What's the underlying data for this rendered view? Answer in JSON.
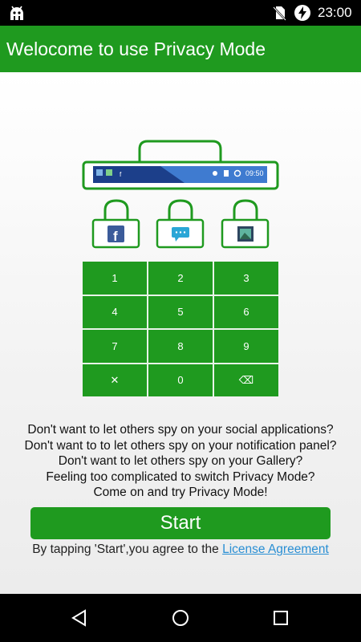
{
  "status_bar": {
    "time": "23:00",
    "icons": [
      "android-icon",
      "no-sim-icon",
      "battery-charging-icon"
    ]
  },
  "app_bar": {
    "title": "Welocome to use Privacy Mode"
  },
  "illustration": {
    "mini_status_time": "09:50",
    "locked_apps": [
      "facebook-icon",
      "messaging-icon",
      "gallery-icon"
    ]
  },
  "keypad": {
    "keys": [
      "1",
      "2",
      "3",
      "4",
      "5",
      "6",
      "7",
      "8",
      "9",
      "✕",
      "0",
      "⌫"
    ]
  },
  "message": {
    "lines": [
      "Don't want to let others spy on your social applications?",
      "Don't want to to let others spy on your notification panel?",
      "Don't want to let others spy on your Gallery?",
      "Feeling too complicated to switch Privacy Mode?",
      "Come on and try Privacy Mode!"
    ]
  },
  "start_button": {
    "label": "Start"
  },
  "agreement": {
    "prefix": "By tapping 'Start',you agree to the ",
    "link": "License Agreement"
  },
  "nav_bar": {
    "icons": [
      "back-icon",
      "home-icon",
      "recents-icon"
    ]
  },
  "colors": {
    "primary_green": "#1f9a1f",
    "link_blue": "#2a8fd4",
    "status_black": "#000000"
  }
}
